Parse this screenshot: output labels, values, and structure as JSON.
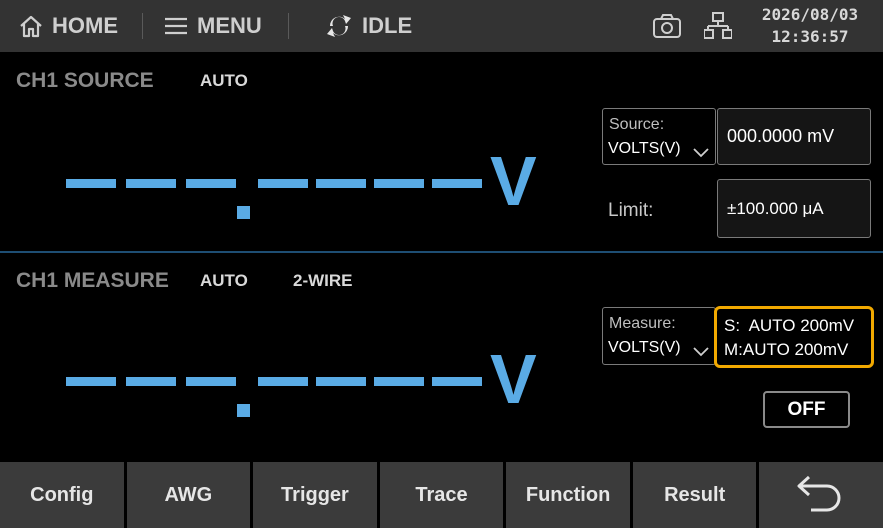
{
  "topbar": {
    "home_label": "HOME",
    "menu_label": "MENU",
    "status_label": "IDLE",
    "date": "2026/08/03",
    "time": "12:36:57"
  },
  "source": {
    "title": "CH1 SOURCE",
    "mode": "AUTO",
    "readout_value": "---.-----",
    "readout_unit": "V",
    "function_label": "Source:",
    "function_value": "VOLTS(V)",
    "level_value": "000.0000 mV",
    "limit_label": "Limit:",
    "limit_value": "±100.000 μA"
  },
  "measure": {
    "title": "CH1 MEASURE",
    "mode": "AUTO",
    "wiring": "2-WIRE",
    "readout_value": "---.-----",
    "readout_unit": "V",
    "function_label": "Measure:",
    "function_value": "VOLTS(V)",
    "range_source": "S:  AUTO 200mV",
    "range_measure": "M:AUTO 200mV",
    "output_label": "OFF"
  },
  "softkeys": [
    "Config",
    "AWG",
    "Trigger",
    "Trace",
    "Function",
    "Result"
  ],
  "colors": {
    "accent": "#5aabe5",
    "highlight": "#f2a900",
    "topbar": "#333333",
    "softkey": "#3b3b3b"
  },
  "icons": [
    "home-icon",
    "menu-icon",
    "refresh-icon",
    "camera-icon",
    "network-icon",
    "chevron-down-icon",
    "back-arrow-icon"
  ]
}
